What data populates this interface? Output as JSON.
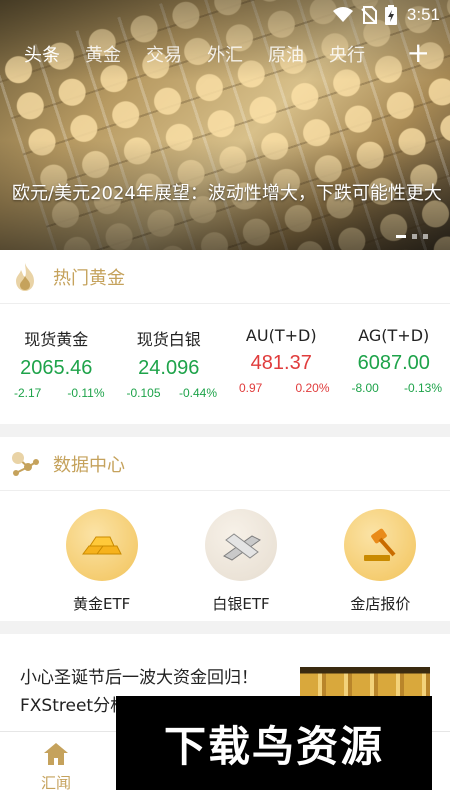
{
  "status_bar": {
    "time": "3:51"
  },
  "tabs": [
    "头条",
    "黄金",
    "交易",
    "外汇",
    "原油",
    "央行"
  ],
  "tab_add": "+",
  "banner": {
    "title": "欧元/美元2024年展望：波动性增大，下跌可能性更大"
  },
  "hot_gold": {
    "title": "热门黄金",
    "quotes": [
      {
        "name": "现货黄金",
        "price": "2065.46",
        "change": "-2.17",
        "percent": "-0.11%",
        "trend": "down"
      },
      {
        "name": "现货白银",
        "price": "24.096",
        "change": "-0.105",
        "percent": "-0.44%",
        "trend": "down"
      },
      {
        "name": "AU(T+D)",
        "price": "481.37",
        "change": "0.97",
        "percent": "0.20%",
        "trend": "up"
      },
      {
        "name": "AG(T+D)",
        "price": "6087.00",
        "change": "-8.00",
        "percent": "-0.13%",
        "trend": "down"
      }
    ]
  },
  "data_center": {
    "title": "数据中心",
    "items": [
      {
        "label": "黄金ETF",
        "icon": "gold-bars-icon"
      },
      {
        "label": "白银ETF",
        "icon": "silver-bars-icon"
      },
      {
        "label": "金店报价",
        "icon": "auction-hammer-icon"
      }
    ]
  },
  "news": {
    "title": "小心圣诞节后一波大资金回归！FXStreet分析师：金价即"
  },
  "bottom_nav": {
    "label": "汇闻",
    "icon": "home-icon"
  },
  "watermark": "下载鸟资源",
  "colors": {
    "accent_gold": "#c5a25c",
    "up": "#e03c3c",
    "down": "#1ea34a"
  }
}
